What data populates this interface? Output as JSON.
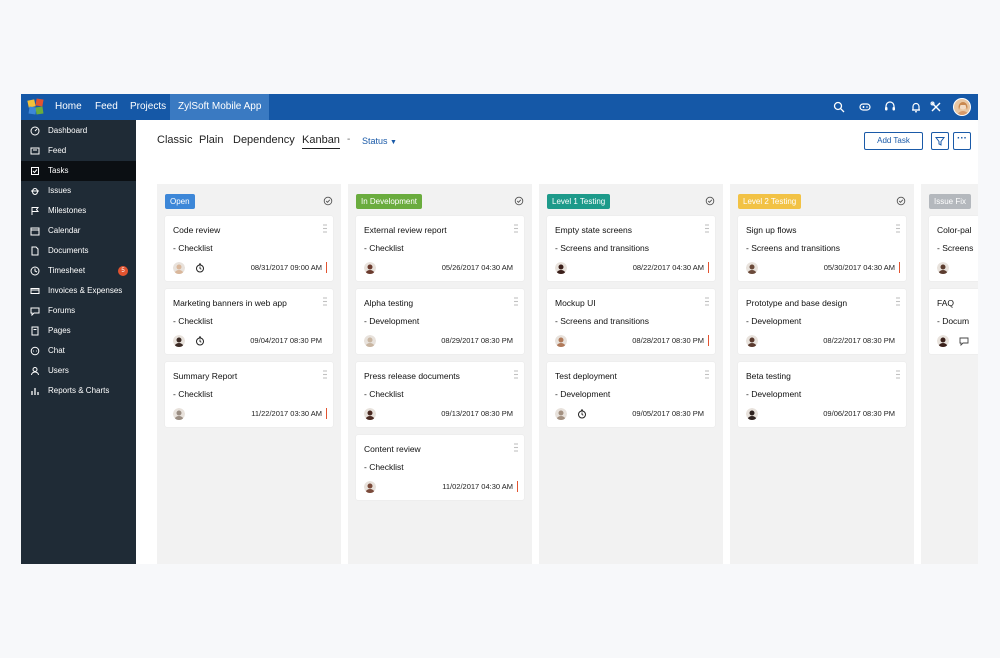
{
  "colors": {
    "topbar": "#1558a7",
    "sidebar": "#1f2b36",
    "accent": "#1a5aa8",
    "priority_high": "#e2532f"
  },
  "topbar": {
    "nav": [
      "Home",
      "Feed",
      "Projects"
    ],
    "active_project": "ZylSoft Mobile App",
    "icons": [
      "search-icon",
      "gamepad-icon",
      "support-icon",
      "timer-icon",
      "bell-icon",
      "tools-icon"
    ]
  },
  "sidebar": {
    "items": [
      {
        "label": "Dashboard",
        "icon": "dashboard-icon"
      },
      {
        "label": "Feed",
        "icon": "feed-icon"
      },
      {
        "label": "Tasks",
        "icon": "tasks-icon"
      },
      {
        "label": "Issues",
        "icon": "bug-icon"
      },
      {
        "label": "Milestones",
        "icon": "milestone-icon"
      },
      {
        "label": "Calendar",
        "icon": "calendar-icon"
      },
      {
        "label": "Documents",
        "icon": "document-icon"
      },
      {
        "label": "Timesheet",
        "icon": "clock-icon",
        "badge": "5"
      },
      {
        "label": "Invoices & Expenses",
        "icon": "invoice-icon"
      },
      {
        "label": "Forums",
        "icon": "forum-icon"
      },
      {
        "label": "Pages",
        "icon": "page-icon"
      },
      {
        "label": "Chat",
        "icon": "chat-icon"
      },
      {
        "label": "Users",
        "icon": "users-icon"
      },
      {
        "label": "Reports & Charts",
        "icon": "chart-icon"
      }
    ],
    "active": "Tasks"
  },
  "views": {
    "tabs": [
      "Classic",
      "Plain",
      "Dependency",
      "Kanban"
    ],
    "active": "Kanban",
    "separator": "-",
    "group_by": "Status",
    "add_task": "Add Task"
  },
  "columns": [
    {
      "status": "Open",
      "color": "#3d87d8",
      "cards": [
        {
          "title": "Code review",
          "sub": "- Checklist",
          "date": "08/31/2017 09:00 AM",
          "clock": true,
          "priority": "#e2532f",
          "avatar": "#d9b79b"
        },
        {
          "title": "Marketing banners in web app",
          "sub": "- Checklist",
          "date": "09/04/2017 08:30 PM",
          "clock": true,
          "priority": "",
          "avatar": "#3b2a24"
        },
        {
          "title": "Summary Report",
          "sub": "- Checklist",
          "date": "11/22/2017 03:30 AM",
          "clock": false,
          "priority": "#e2532f",
          "avatar": "#9a8d82"
        }
      ]
    },
    {
      "status": "In Development",
      "color": "#6aac3e",
      "cards": [
        {
          "title": "External review report",
          "sub": "- Checklist",
          "date": "05/26/2017 04:30 AM",
          "clock": false,
          "priority": "",
          "avatar": "#6b3b2e"
        },
        {
          "title": "Alpha testing",
          "sub": "- Development",
          "date": "08/29/2017 08:30 PM",
          "clock": false,
          "priority": "",
          "avatar": "#c9b6a2"
        },
        {
          "title": "Press release documents",
          "sub": "- Checklist",
          "date": "09/13/2017 08:30 PM",
          "clock": false,
          "priority": "",
          "avatar": "#4a2a22"
        },
        {
          "title": "Content review",
          "sub": "- Checklist",
          "date": "11/02/2017 04:30 AM",
          "clock": false,
          "priority": "#e2532f",
          "avatar": "#7a4a3a"
        }
      ]
    },
    {
      "status": "Level 1 Testing",
      "color": "#1d9a8a",
      "cards": [
        {
          "title": "Empty state screens",
          "sub": "- Screens and transitions",
          "date": "08/22/2017 04:30 AM",
          "clock": false,
          "priority": "#e2532f",
          "avatar": "#3b1f1a"
        },
        {
          "title": "Mockup UI",
          "sub": "- Screens and transitions",
          "date": "08/28/2017 08:30 PM",
          "clock": false,
          "priority": "#e2532f",
          "avatar": "#b07a5a"
        },
        {
          "title": "Test deployment",
          "sub": "- Development",
          "date": "09/05/2017 08:30 PM",
          "clock": true,
          "priority": "",
          "avatar": "#a39080"
        }
      ]
    },
    {
      "status": "Level 2 Testing",
      "color": "#f2c245",
      "cards": [
        {
          "title": "Sign up flows",
          "sub": "- Screens and transitions",
          "date": "05/30/2017 04:30 AM",
          "clock": false,
          "priority": "#e2532f",
          "avatar": "#6b4a3a"
        },
        {
          "title": "Prototype and base design",
          "sub": "- Development",
          "date": "08/22/2017 08:30 PM",
          "clock": false,
          "priority": "",
          "avatar": "#5a3a2e"
        },
        {
          "title": "Beta testing",
          "sub": "- Development",
          "date": "09/06/2017 08:30 PM",
          "clock": false,
          "priority": "",
          "avatar": "#2f2320"
        }
      ]
    },
    {
      "status": "Issue Fix",
      "color": "#b4b8bd",
      "cards": [
        {
          "title": "Color-pal",
          "sub": "- Screens",
          "date": "",
          "clock": false,
          "priority": "",
          "avatar": "#5c3d30"
        },
        {
          "title": "FAQ",
          "sub": "- Docum",
          "date": "",
          "clock": false,
          "comment": true,
          "priority": "",
          "avatar": "#3a201b"
        }
      ]
    }
  ]
}
